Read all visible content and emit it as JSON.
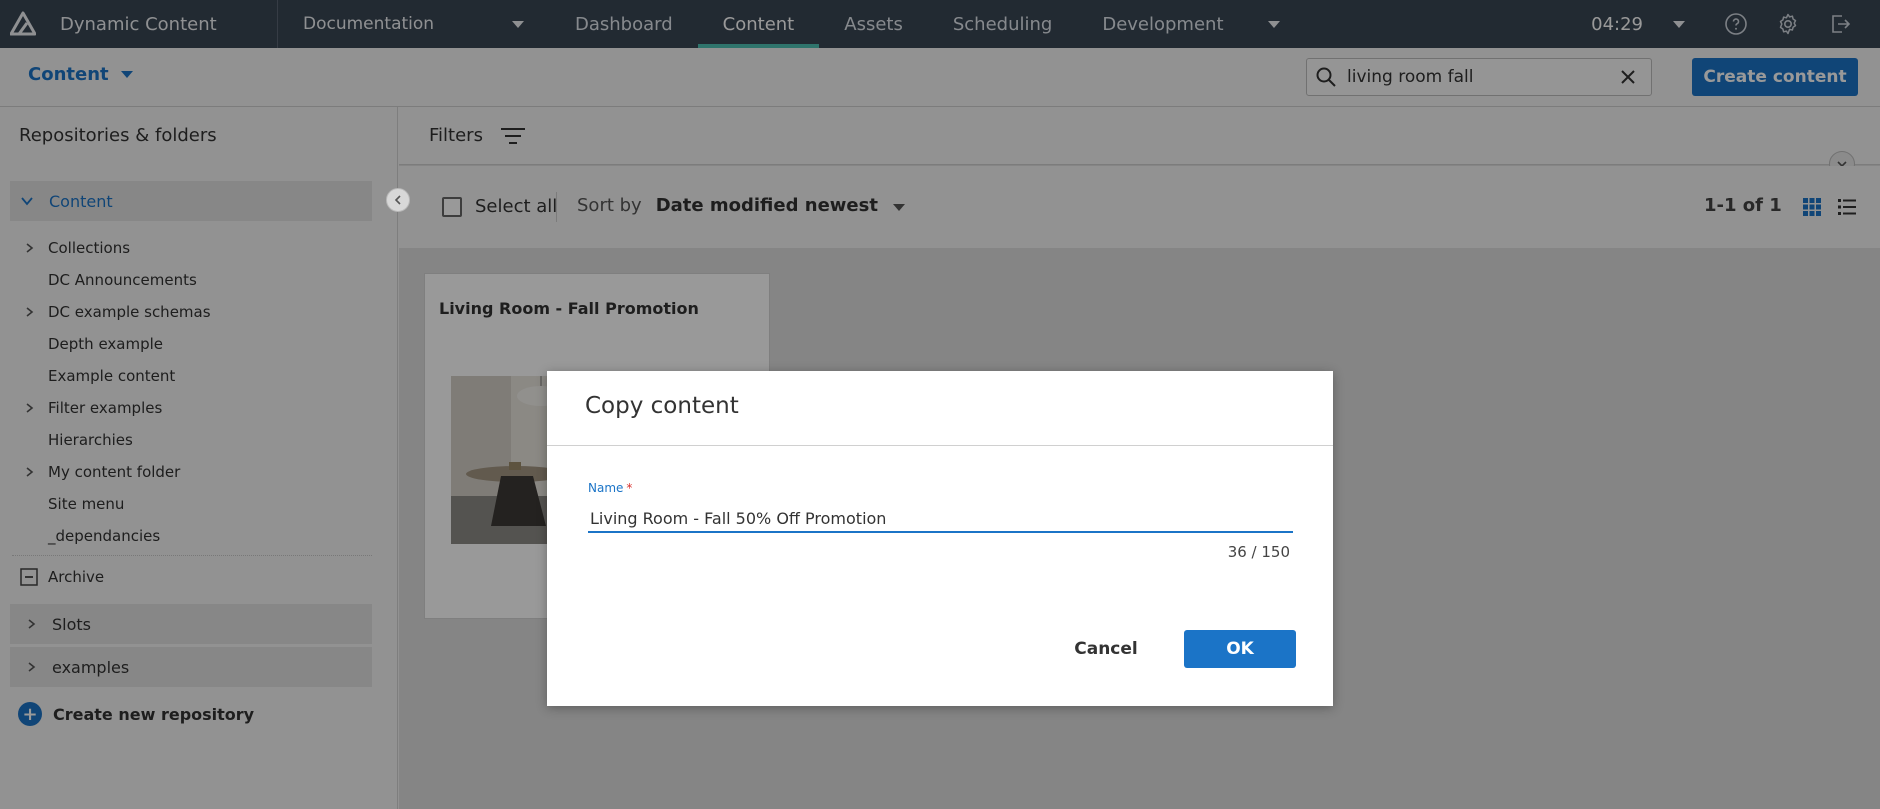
{
  "app": {
    "name": "Dynamic Content"
  },
  "topnav": {
    "hub": "Documentation",
    "tabs": [
      {
        "label": "Dashboard"
      },
      {
        "label": "Content"
      },
      {
        "label": "Assets"
      },
      {
        "label": "Scheduling"
      },
      {
        "label": "Development"
      }
    ],
    "active_tab": "Content",
    "clock": "04:29"
  },
  "subheader": {
    "content_dropdown": "Content",
    "search_value": "living room fall",
    "create_button": "Create content"
  },
  "sidebar": {
    "title": "Repositories & folders",
    "root": "Content",
    "items": [
      {
        "label": "Collections",
        "expandable": true
      },
      {
        "label": "DC Announcements",
        "expandable": false
      },
      {
        "label": "DC example schemas",
        "expandable": true
      },
      {
        "label": "Depth example",
        "expandable": false
      },
      {
        "label": "Example content",
        "expandable": false
      },
      {
        "label": "Filter examples",
        "expandable": true
      },
      {
        "label": "Hierarchies",
        "expandable": false
      },
      {
        "label": "My content folder",
        "expandable": true
      },
      {
        "label": "Site menu",
        "expandable": false
      },
      {
        "label": "_dependancies",
        "expandable": false
      }
    ],
    "archive": "Archive",
    "repositories": [
      "Slots",
      "examples"
    ],
    "create_repo": "Create new repository"
  },
  "main": {
    "filters": "Filters",
    "select_all": "Select all",
    "sort_label": "Sort by",
    "sort_value": "Date modified newest",
    "count": "1-1 of 1",
    "cards": [
      {
        "title": "Living Room - Fall Promotion"
      }
    ]
  },
  "dialog": {
    "title": "Copy content",
    "field_label": "Name",
    "required_mark": "*",
    "field_value": "Living Room - Fall 50% Off Promotion",
    "char_count": "36 / 150",
    "cancel": "Cancel",
    "ok": "OK"
  },
  "colors": {
    "accent": "#1b74c7",
    "nav_bg": "#3a4654",
    "active_tab_underline": "#4fc1b4"
  }
}
